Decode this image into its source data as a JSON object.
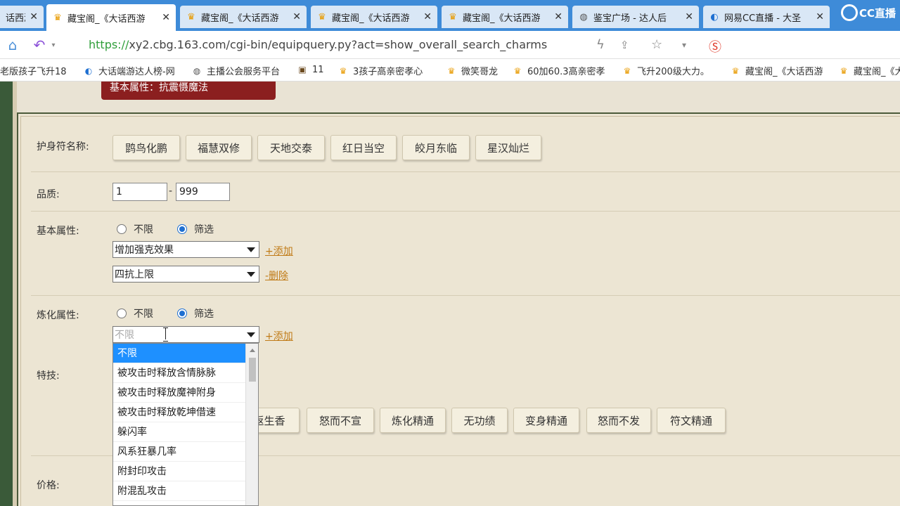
{
  "browser": {
    "tabs": [
      {
        "label": "话西游",
        "icon": "gold-ingot-icon",
        "active": false
      },
      {
        "label": "藏宝阁_《大话西游",
        "icon": "gold-ingot-icon",
        "active": true
      },
      {
        "label": "藏宝阁_《大话西游",
        "icon": "gold-ingot-icon",
        "active": false
      },
      {
        "label": "藏宝阁_《大话西游",
        "icon": "gold-ingot-icon",
        "active": false
      },
      {
        "label": "藏宝阁_《大话西游",
        "icon": "gold-ingot-icon",
        "active": false
      },
      {
        "label": "鉴宝广场 - 达人后",
        "icon": "globe-icon",
        "active": false
      },
      {
        "label": "网易CC直播 - 大圣",
        "icon": "cc-icon",
        "active": false
      }
    ],
    "tab_close_glyph": "✕",
    "cc_badge": "CC直播",
    "url_protocol": "https://",
    "url_rest": "xy2.cbg.163.com/cgi-bin/equipquery.py?act=show_overall_search_charms",
    "bookmarks": [
      {
        "label": "老版孩子飞升18",
        "icon": ""
      },
      {
        "label": "大话端游达人榜-网",
        "icon": "cc-icon"
      },
      {
        "label": "主播公会服务平台",
        "icon": "globe-icon"
      },
      {
        "label": "11",
        "icon": "image-icon"
      },
      {
        "label": "3孩子高亲密孝心",
        "icon": "gold-ingot-icon"
      },
      {
        "label": "微笑哥龙",
        "icon": "gold-ingot-icon"
      },
      {
        "label": "60加60.3高亲密孝",
        "icon": "gold-ingot-icon"
      },
      {
        "label": "飞升200级大力。",
        "icon": "gold-ingot-icon"
      },
      {
        "label": "藏宝阁_《大话西游",
        "icon": "gold-ingot-icon"
      },
      {
        "label": "藏宝阁_《大",
        "icon": "gold-ingot-icon"
      }
    ]
  },
  "page": {
    "banner_text": "基本属性：抗震慑魔法",
    "charm_name_label": "护身符名称:",
    "charm_names": [
      "鹍鸟化鹏",
      "福慧双修",
      "天地交泰",
      "红日当空",
      "皎月东临",
      "星汉灿烂"
    ],
    "quality_label": "品质:",
    "quality_min": "1",
    "quality_max": "999",
    "quality_sep": "-",
    "basic_attr_label": "基本属性:",
    "radio_unlimited": "不限",
    "radio_filter": "筛选",
    "basic_select_1": "增加强克效果",
    "basic_select_2": "四抗上限",
    "add_link": "+添加",
    "delete_link": "-删除",
    "refine_attr_label": "炼化属性:",
    "refine_select_placeholder": "不限",
    "refine_add_link": "+添加",
    "skill_label": "特技:",
    "skill_chips": [
      "返生香",
      "怒而不宣",
      "炼化精通",
      "无功绩",
      "变身精通",
      "怒而不发",
      "符文精通"
    ],
    "price_label": "价格:"
  },
  "dropdown": {
    "options": [
      "不限",
      "被攻击时释放含情脉脉",
      "被攻击时释放魔神附身",
      "被攻击时释放乾坤借速",
      "躲闪率",
      "风系狂暴几率",
      "附封印攻击",
      "附混乱攻击"
    ],
    "selected_index": 0
  },
  "colors": {
    "tab_strip": "#3e8bd8",
    "page_bg": "#e9e3d4",
    "banner": "#8b1f1f",
    "link": "#c07a16",
    "selected_option": "#1e90ff"
  }
}
